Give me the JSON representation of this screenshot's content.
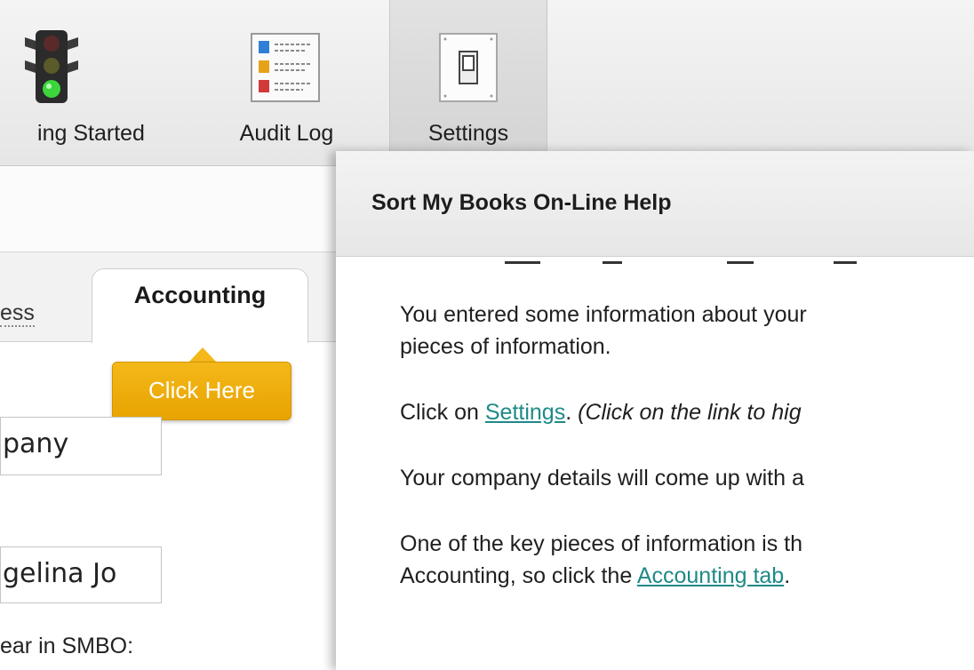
{
  "toolbar": {
    "items": [
      {
        "label": "ing Started",
        "icon": "traffic-light-icon"
      },
      {
        "label": "Audit Log",
        "icon": "audit-log-icon"
      },
      {
        "label": "Settings",
        "icon": "settings-switch-icon",
        "active": true
      }
    ]
  },
  "tabs": {
    "inactive_label": "ess",
    "active_label": "Accounting"
  },
  "tooltip": {
    "label": "Click Here",
    "color": "#f0ad0a"
  },
  "form": {
    "company_value": "pany",
    "name_value": "gelina Jo",
    "year_label": "ear in SMBO:"
  },
  "help": {
    "title": "Sort My Books On-Line Help",
    "p1_line1": "You entered some information about your",
    "p1_line2": "pieces of information.",
    "p2_prefix": "Click on ",
    "p2_link": "Settings",
    "p2_dot": ". ",
    "p2_italic": "(Click on the link to hig",
    "p3": "Your company details will come up with a",
    "p4_line1": "One of the key pieces of information is th",
    "p4_line2_prefix": "Accounting, so click the ",
    "p4_link": "Accounting tab",
    "p4_dot": ".",
    "link_color": "#1e8a87"
  }
}
